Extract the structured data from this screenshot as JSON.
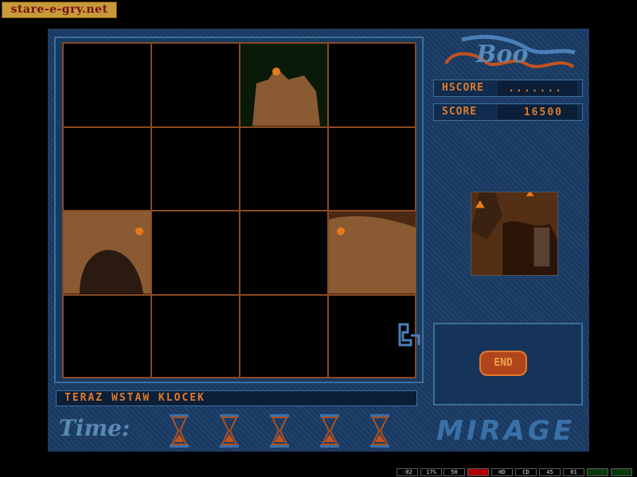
{
  "watermark": "stare-e-gry.net",
  "logo_text": "Boo",
  "hscore": {
    "label": "HSCORE",
    "value": "......."
  },
  "score": {
    "label": "SCORE",
    "value": "16500"
  },
  "message": "TERAZ WSTAW KLOCEK",
  "end_button": "END",
  "time_label": "Time:",
  "hourglasses": 5,
  "publisher_logo": "MIRAGE",
  "status_bar": [
    "-02",
    "17%",
    "50",
    "",
    "HD",
    "CD",
    "45",
    "01",
    "",
    ""
  ],
  "colors": {
    "accent": "#e07a2c",
    "frame": "#1a3c66",
    "grid_line": "#8a4a22"
  },
  "grid": {
    "rows": 4,
    "cols": 4,
    "filled_tiles": [
      [
        0,
        2
      ],
      [
        2,
        0
      ],
      [
        2,
        3
      ]
    ]
  }
}
